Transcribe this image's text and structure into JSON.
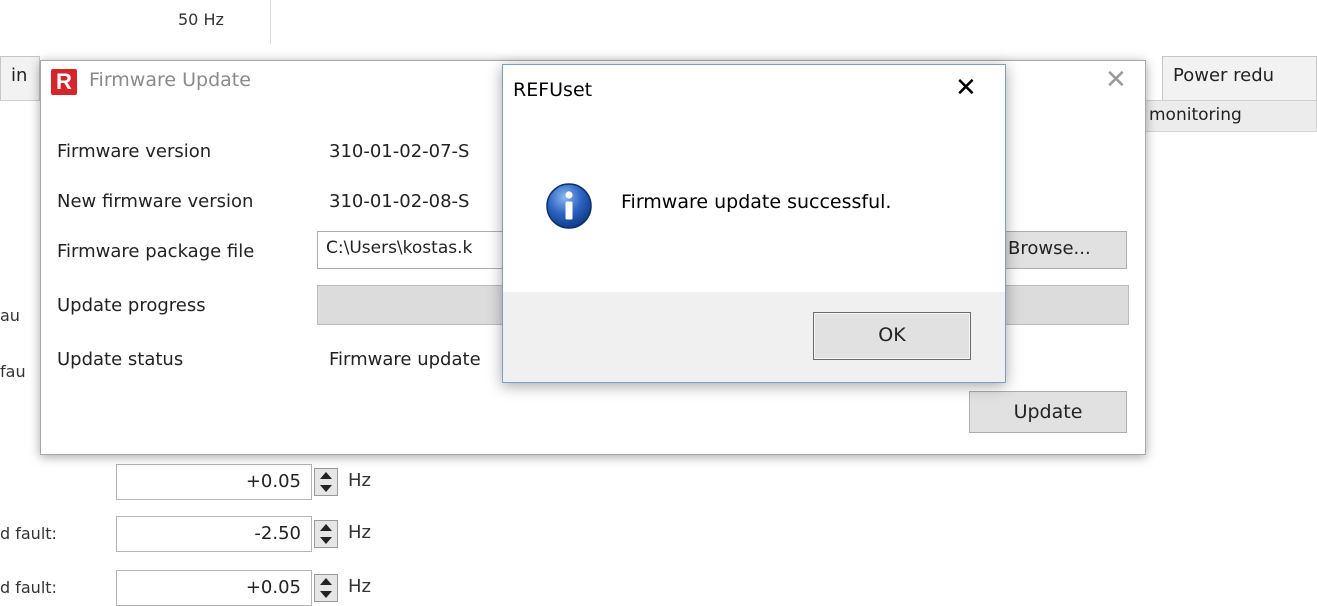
{
  "background": {
    "frequency_value": "50 Hz",
    "tabs": [
      "in",
      "Power redu"
    ],
    "subtab": "monitoring",
    "side_labels": [
      "au",
      "fau"
    ],
    "rows": [
      {
        "label": "",
        "value": "+0.05",
        "unit": "Hz"
      },
      {
        "label": "d fault:",
        "value": "-2.50",
        "unit": "Hz"
      },
      {
        "label": "d fault:",
        "value": "+0.05",
        "unit": "Hz"
      }
    ]
  },
  "firmware_dialog": {
    "title": "Firmware Update",
    "logo_letter": "R",
    "logo_color": "#d7242b",
    "fields": {
      "firmware_version_label": "Firmware version",
      "firmware_version_value": "310-01-02-07-S",
      "new_firmware_version_label": "New firmware version",
      "new_firmware_version_value": "310-01-02-08-S",
      "package_file_label": "Firmware package file",
      "package_file_value": "C:\\Users\\kostas.k",
      "update_progress_label": "Update progress",
      "update_status_label": "Firmware update",
      "update_status_title": "Update status"
    },
    "progress_fraction": 1.0,
    "browse_label": "Browse...",
    "update_label": "Update"
  },
  "message_box": {
    "title": "REFUset",
    "message": "Firmware update successful.",
    "ok_label": "OK",
    "icon": "info-icon"
  }
}
